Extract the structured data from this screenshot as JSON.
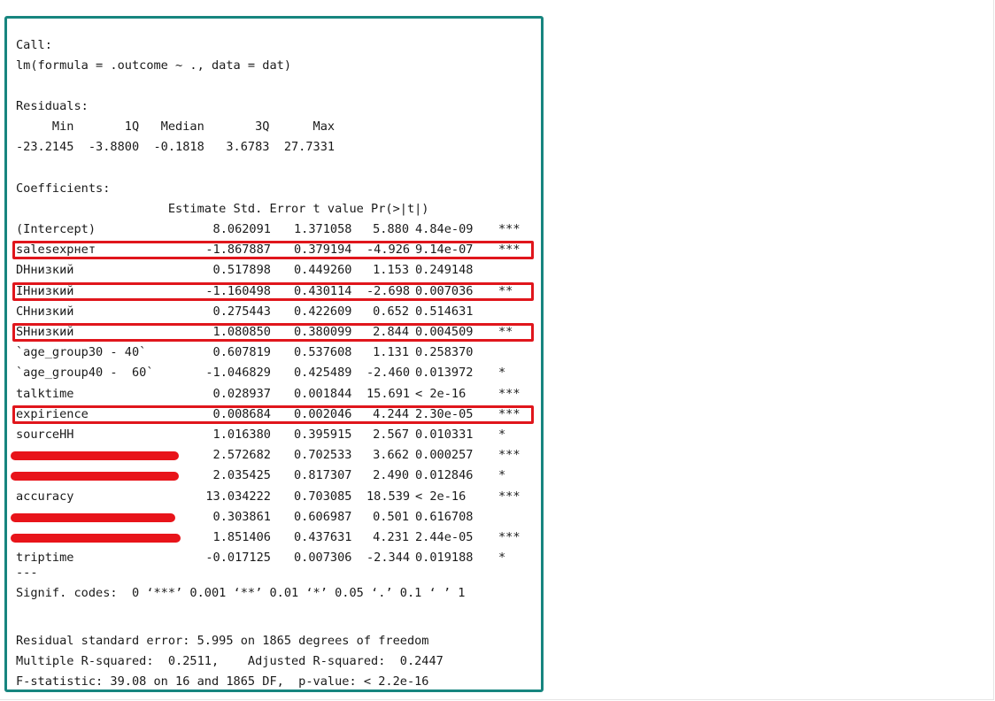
{
  "call_header": "Call:",
  "call_formula": "lm(formula = .outcome ~ ., data = dat)",
  "residuals_header": "Residuals:",
  "residuals_quantile_labels": "     Min       1Q   Median       3Q      Max",
  "residuals_quantile_values": "-23.2145  -3.8800  -0.1818   3.6783  27.7331",
  "coefficients_header": "Coefficients:",
  "coef_columns": "                     Estimate Std. Error t value Pr(>|t|)",
  "coefficients": [
    {
      "name": "(Intercept)",
      "estimate": "8.062091",
      "std_error": "1.371058",
      "t_value": "5.880",
      "p_value": "4.84e-09",
      "sig": "***",
      "highlighted": false
    },
    {
      "name": "salesexpнет",
      "estimate": "-1.867887",
      "std_error": "0.379194",
      "t_value": "-4.926",
      "p_value": "9.14e-07",
      "sig": "***",
      "highlighted": true
    },
    {
      "name": "DHнизкий",
      "estimate": "0.517898",
      "std_error": "0.449260",
      "t_value": "1.153",
      "p_value": "0.249148",
      "sig": "",
      "highlighted": false
    },
    {
      "name": "IHнизкий",
      "estimate": "-1.160498",
      "std_error": "0.430114",
      "t_value": "-2.698",
      "p_value": "0.007036",
      "sig": "**",
      "highlighted": true
    },
    {
      "name": "CHнизкий",
      "estimate": "0.275443",
      "std_error": "0.422609",
      "t_value": "0.652",
      "p_value": "0.514631",
      "sig": "",
      "highlighted": false
    },
    {
      "name": "SHнизкий",
      "estimate": "1.080850",
      "std_error": "0.380099",
      "t_value": "2.844",
      "p_value": "0.004509",
      "sig": "**",
      "highlighted": true
    },
    {
      "name": "`age_group30 - 40`",
      "estimate": "0.607819",
      "std_error": "0.537608",
      "t_value": "1.131",
      "p_value": "0.258370",
      "sig": "",
      "highlighted": false
    },
    {
      "name": "`age_group40 -  60`",
      "estimate": "-1.046829",
      "std_error": "0.425489",
      "t_value": "-2.460",
      "p_value": "0.013972",
      "sig": "*",
      "highlighted": false
    },
    {
      "name": "talktime",
      "estimate": "0.028937",
      "std_error": "0.001844",
      "t_value": "15.691",
      "p_value": "< 2e-16",
      "sig": "***",
      "highlighted": false
    },
    {
      "name": "expirience",
      "estimate": "0.008684",
      "std_error": "0.002046",
      "t_value": "4.244",
      "p_value": "2.30e-05",
      "sig": "***",
      "highlighted": true
    },
    {
      "name": "sourceHH",
      "estimate": "1.016380",
      "std_error": "0.395915",
      "t_value": "2.567",
      "p_value": "0.010331",
      "sig": "*",
      "highlighted": false
    },
    {
      "name": "",
      "estimate": "2.572682",
      "std_error": "0.702533",
      "t_value": "3.662",
      "p_value": "0.000257",
      "sig": "***",
      "highlighted": false
    },
    {
      "name": "",
      "estimate": "2.035425",
      "std_error": "0.817307",
      "t_value": "2.490",
      "p_value": "0.012846",
      "sig": "*",
      "highlighted": false
    },
    {
      "name": "accuracy",
      "estimate": "13.034222",
      "std_error": "0.703085",
      "t_value": "18.539",
      "p_value": "< 2e-16",
      "sig": "***",
      "highlighted": false
    },
    {
      "name": "",
      "estimate": "0.303861",
      "std_error": "0.606987",
      "t_value": "0.501",
      "p_value": "0.616708",
      "sig": "",
      "highlighted": false
    },
    {
      "name": "",
      "estimate": "1.851406",
      "std_error": "0.437631",
      "t_value": "4.231",
      "p_value": "2.44e-05",
      "sig": "***",
      "highlighted": false
    },
    {
      "name": "triptime",
      "estimate": "-0.017125",
      "std_error": "0.007306",
      "t_value": "-2.344",
      "p_value": "0.019188",
      "sig": "*",
      "highlighted": false
    }
  ],
  "separator": "---",
  "signif_codes": "Signif. codes:  0 ‘***’ 0.001 ‘**’ 0.01 ‘*’ 0.05 ‘.’ 0.1 ‘ ’ 1",
  "residual_se": "Residual standard error: 5.995 on 1865 degrees of freedom",
  "r_squared": "Multiple R-squared:  0.2511,    Adjusted R-squared:  0.2447",
  "f_statistic": "F-statistic: 39.08 on 16 and 1865 DF,  p-value: < 2.2e-16",
  "colors": {
    "frame_border": "#17857f",
    "highlight_border": "#e0161c",
    "redaction": "#e8141a"
  }
}
